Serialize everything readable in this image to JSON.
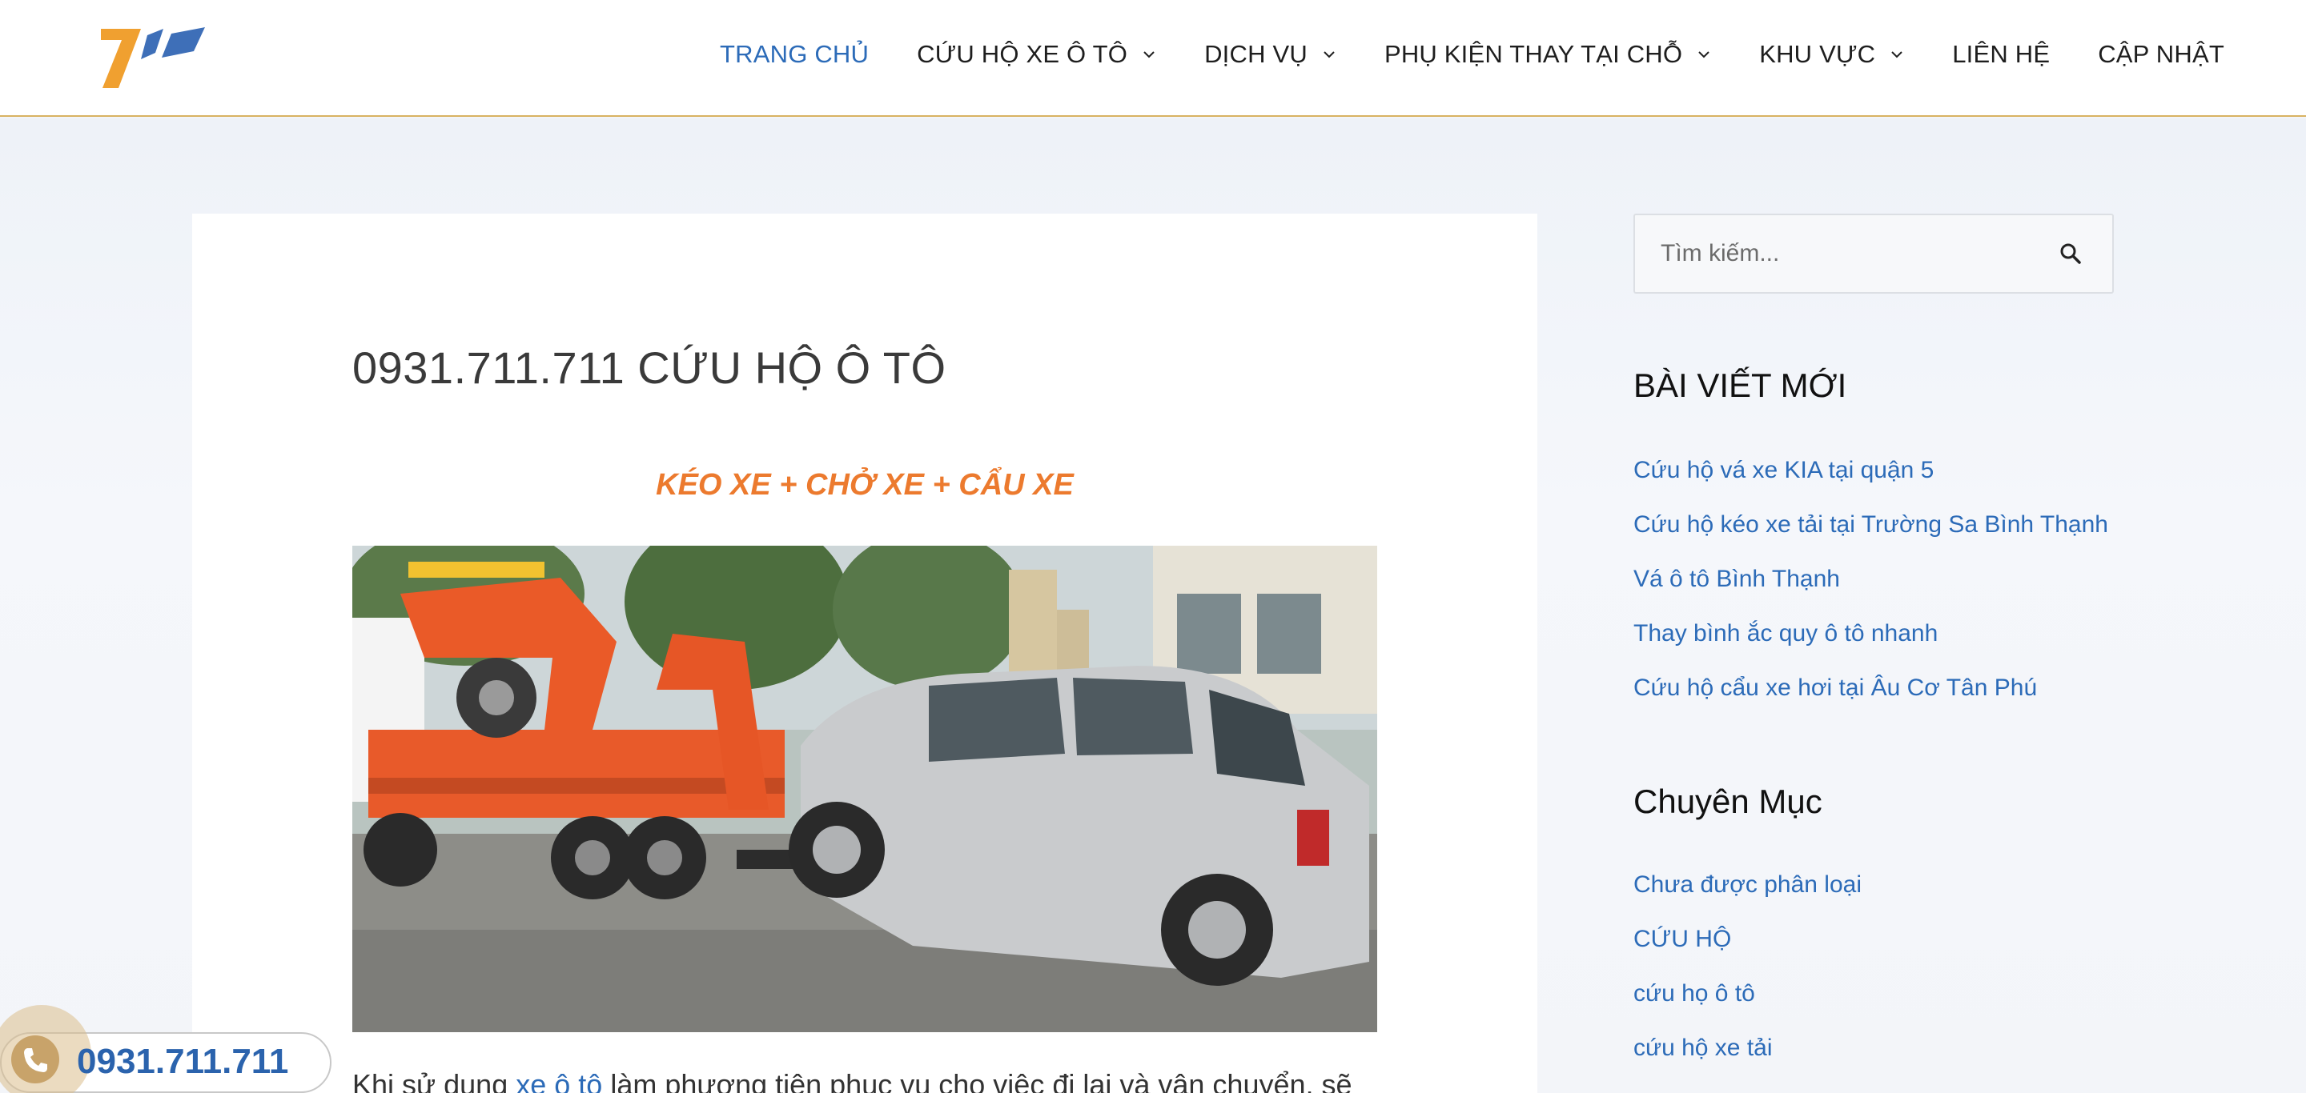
{
  "header": {
    "nav": [
      {
        "label": "TRANG CHỦ",
        "active": true,
        "dropdown": false
      },
      {
        "label": "CỨU HỘ XE Ô TÔ",
        "active": false,
        "dropdown": true
      },
      {
        "label": "DỊCH VỤ",
        "active": false,
        "dropdown": true
      },
      {
        "label": "PHỤ KIỆN THAY TẠI CHỖ",
        "active": false,
        "dropdown": true
      },
      {
        "label": "KHU VỰC",
        "active": false,
        "dropdown": true
      },
      {
        "label": "LIÊN HỆ",
        "active": false,
        "dropdown": false
      },
      {
        "label": "CẬP NHẬT",
        "active": false,
        "dropdown": false
      }
    ]
  },
  "post": {
    "title": "0931.711.711 CỨU HỘ Ô TÔ",
    "subheading": "KÉO XE + CHỞ XE + CẨU XE",
    "body_prefix": "Khi sử dụng ",
    "body_link": "xe ô tô",
    "body_suffix": " làm phương tiện phục vụ cho việc đi lại và vận chuyển, sẽ"
  },
  "sidebar": {
    "search": {
      "placeholder": "Tìm kiếm..."
    },
    "recent_title": "BÀI VIẾT MỚI",
    "recent_posts": [
      "Cứu hộ vá xe KIA tại quận 5",
      "Cứu hộ kéo xe tải tại Trường Sa Bình Thạnh",
      "Vá ô tô Bình Thạnh",
      "Thay bình ắc quy ô tô nhanh",
      "Cứu hộ cẩu xe hơi tại Âu Cơ Tân Phú"
    ],
    "categories_title": "Chuyên Mục",
    "categories": [
      "Chưa được phân loại",
      "CỨU HỘ",
      "cứu họ ô tô",
      "cứu hộ xe tải"
    ]
  },
  "floating_phone": {
    "number": "0931.711.711"
  },
  "colors": {
    "accent": "#2c6bb8",
    "orange": "#ec7a2e",
    "header_border": "#d8b262",
    "logo_orange": "#f0a030",
    "logo_blue": "#3e6fb8"
  }
}
